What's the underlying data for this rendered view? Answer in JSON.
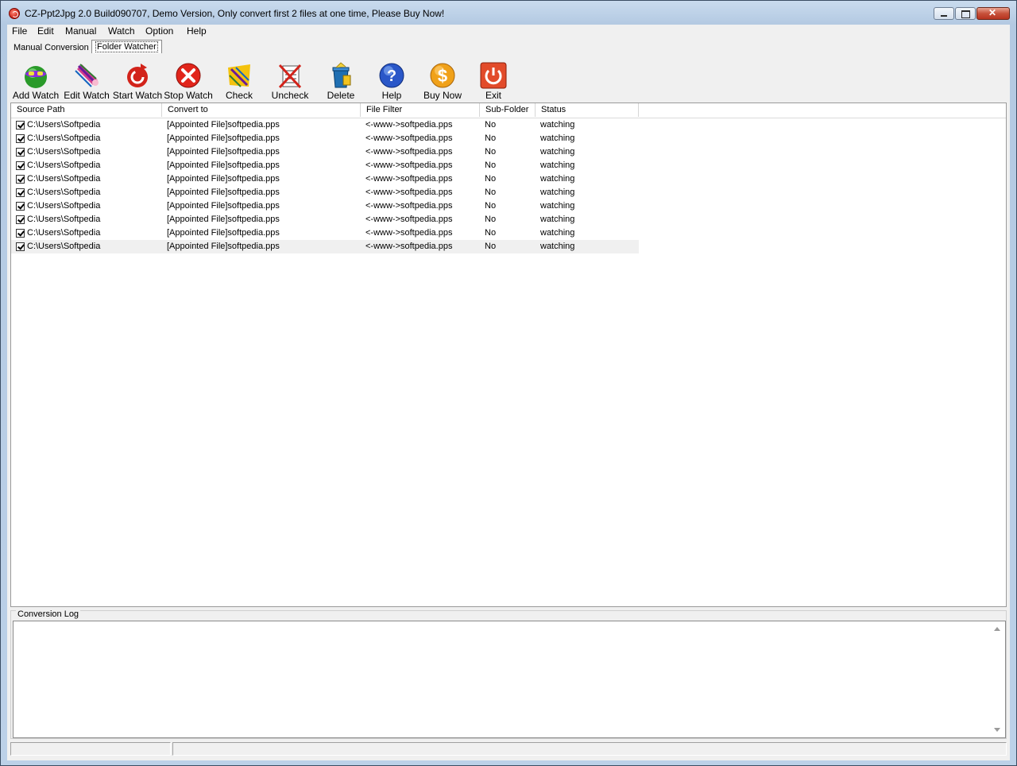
{
  "window": {
    "title": "CZ-Ppt2Jpg 2.0 Build090707, Demo Version, Only convert first 2 files at one time, Please Buy Now!"
  },
  "menu": [
    "File",
    "Edit",
    "Manual",
    "Watch",
    "Option",
    "Help"
  ],
  "tabs": [
    "Manual Conversion",
    "Folder Watcher"
  ],
  "toolbar": [
    {
      "label": "Add Watch",
      "icon": "add-watch-icon"
    },
    {
      "label": "Edit Watch",
      "icon": "edit-watch-icon"
    },
    {
      "label": "Start Watch",
      "icon": "start-watch-icon"
    },
    {
      "label": "Stop Watch",
      "icon": "stop-watch-icon"
    },
    {
      "label": "Check",
      "icon": "check-icon"
    },
    {
      "label": "Uncheck",
      "icon": "uncheck-icon"
    },
    {
      "label": "Delete",
      "icon": "delete-icon"
    },
    {
      "label": "Help",
      "icon": "help-icon"
    },
    {
      "label": "Buy Now",
      "icon": "buy-now-icon"
    },
    {
      "label": "Exit",
      "icon": "exit-icon"
    }
  ],
  "table": {
    "headers": [
      "Source Path",
      "Convert to",
      "File Filter",
      "Sub-Folder",
      "Status"
    ],
    "rows": [
      {
        "checked": true,
        "source": "C:\\Users\\Softpedia",
        "convert_to": "[Appointed File]softpedia.pps",
        "filter": "<-www->softpedia.pps",
        "subfolder": "No",
        "status": "watching"
      },
      {
        "checked": true,
        "source": "C:\\Users\\Softpedia",
        "convert_to": "[Appointed File]softpedia.pps",
        "filter": "<-www->softpedia.pps",
        "subfolder": "No",
        "status": "watching"
      },
      {
        "checked": true,
        "source": "C:\\Users\\Softpedia",
        "convert_to": "[Appointed File]softpedia.pps",
        "filter": "<-www->softpedia.pps",
        "subfolder": "No",
        "status": "watching"
      },
      {
        "checked": true,
        "source": "C:\\Users\\Softpedia",
        "convert_to": "[Appointed File]softpedia.pps",
        "filter": "<-www->softpedia.pps",
        "subfolder": "No",
        "status": "watching"
      },
      {
        "checked": true,
        "source": "C:\\Users\\Softpedia",
        "convert_to": "[Appointed File]softpedia.pps",
        "filter": "<-www->softpedia.pps",
        "subfolder": "No",
        "status": "watching"
      },
      {
        "checked": true,
        "source": "C:\\Users\\Softpedia",
        "convert_to": "[Appointed File]softpedia.pps",
        "filter": "<-www->softpedia.pps",
        "subfolder": "No",
        "status": "watching"
      },
      {
        "checked": true,
        "source": "C:\\Users\\Softpedia",
        "convert_to": "[Appointed File]softpedia.pps",
        "filter": "<-www->softpedia.pps",
        "subfolder": "No",
        "status": "watching"
      },
      {
        "checked": true,
        "source": "C:\\Users\\Softpedia",
        "convert_to": "[Appointed File]softpedia.pps",
        "filter": "<-www->softpedia.pps",
        "subfolder": "No",
        "status": "watching"
      },
      {
        "checked": true,
        "source": "C:\\Users\\Softpedia",
        "convert_to": "[Appointed File]softpedia.pps",
        "filter": "<-www->softpedia.pps",
        "subfolder": "No",
        "status": "watching"
      },
      {
        "checked": true,
        "source": "C:\\Users\\Softpedia",
        "convert_to": "[Appointed File]softpedia.pps",
        "filter": "<-www->softpedia.pps",
        "subfolder": "No",
        "status": "watching"
      }
    ]
  },
  "log": {
    "label": "Conversion Log",
    "content": ""
  },
  "statusbar": [
    "",
    ""
  ]
}
